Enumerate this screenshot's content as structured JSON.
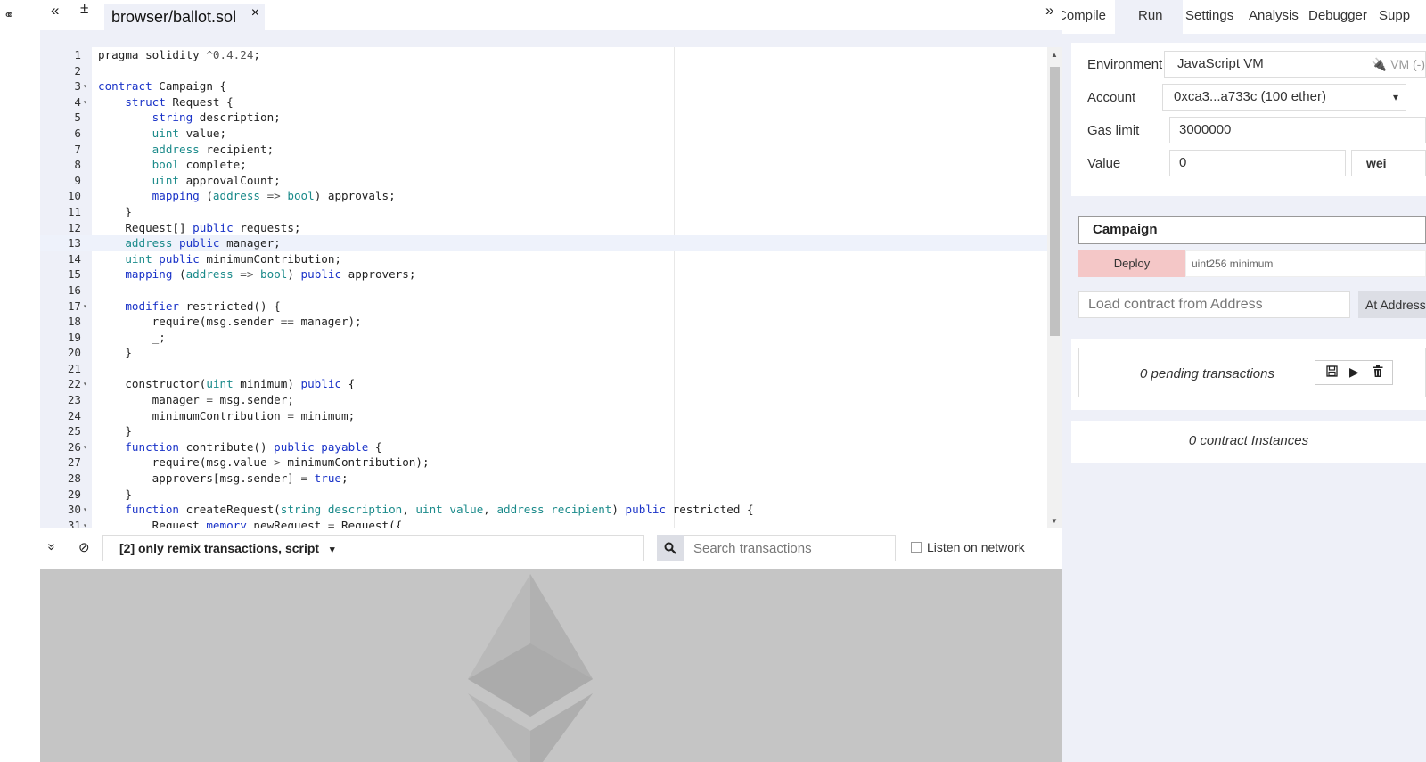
{
  "left_strip": {
    "link_icon": "⚭"
  },
  "editor": {
    "tab_buttons": {
      "collapse_left": "«",
      "new_file": "±",
      "collapse_right": "»"
    },
    "active_tab": "browser/ballot.sol",
    "close_symbol": "×"
  },
  "code_lines": [
    {
      "n": "1",
      "fold": "",
      "html": "pragma solidity <span class=\"op\">^0.4.24</span>;"
    },
    {
      "n": "2",
      "fold": "",
      "html": ""
    },
    {
      "n": "3",
      "fold": "▾",
      "html": "<span class=\"kw\">contract</span> Campaign {"
    },
    {
      "n": "4",
      "fold": "▾",
      "html": "    <span class=\"kw\">struct</span> Request {"
    },
    {
      "n": "5",
      "fold": "",
      "html": "        <span class=\"kw\">string</span> description;"
    },
    {
      "n": "6",
      "fold": "",
      "html": "        <span class=\"ty\">uint</span> value;"
    },
    {
      "n": "7",
      "fold": "",
      "html": "        <span class=\"ty\">address</span> recipient;"
    },
    {
      "n": "8",
      "fold": "",
      "html": "        <span class=\"ty\">bool</span> complete;"
    },
    {
      "n": "9",
      "fold": "",
      "html": "        <span class=\"ty\">uint</span> approvalCount;"
    },
    {
      "n": "10",
      "fold": "",
      "html": "        <span class=\"kw\">mapping</span> (<span class=\"ty\">address</span> <span class=\"op\">=&gt;</span> <span class=\"ty\">bool</span>) approvals;"
    },
    {
      "n": "11",
      "fold": "",
      "html": "    }"
    },
    {
      "n": "12",
      "fold": "",
      "html": "    Request[] <span class=\"kw\">public</span> requests;"
    },
    {
      "n": "13",
      "fold": "",
      "html": "    <span class=\"ty\">address</span> <span class=\"kw\">public</span> manager;",
      "active": true
    },
    {
      "n": "14",
      "fold": "",
      "html": "    <span class=\"ty\">uint</span> <span class=\"kw\">public</span> minimumContribution;"
    },
    {
      "n": "15",
      "fold": "",
      "html": "    <span class=\"kw\">mapping</span> (<span class=\"ty\">address</span> <span class=\"op\">=&gt;</span> <span class=\"ty\">bool</span>) <span class=\"kw\">public</span> approvers;"
    },
    {
      "n": "16",
      "fold": "",
      "html": ""
    },
    {
      "n": "17",
      "fold": "▾",
      "html": "    <span class=\"kw\">modifier</span> restricted() {"
    },
    {
      "n": "18",
      "fold": "",
      "html": "        require(msg.sender <span class=\"op\">==</span> manager);"
    },
    {
      "n": "19",
      "fold": "",
      "html": "        _;"
    },
    {
      "n": "20",
      "fold": "",
      "html": "    }"
    },
    {
      "n": "21",
      "fold": "",
      "html": ""
    },
    {
      "n": "22",
      "fold": "▾",
      "html": "    constructor(<span class=\"ty\">uint</span> minimum) <span class=\"kw\">public</span> {"
    },
    {
      "n": "23",
      "fold": "",
      "html": "        manager <span class=\"op\">=</span> msg.sender;"
    },
    {
      "n": "24",
      "fold": "",
      "html": "        minimumContribution <span class=\"op\">=</span> minimum;"
    },
    {
      "n": "25",
      "fold": "",
      "html": "    }"
    },
    {
      "n": "26",
      "fold": "▾",
      "html": "    <span class=\"kw\">function</span> contribute() <span class=\"kw\">public</span> <span class=\"kw\">payable</span> {"
    },
    {
      "n": "27",
      "fold": "",
      "html": "        require(msg.value <span class=\"op\">&gt;</span> minimumContribution);"
    },
    {
      "n": "28",
      "fold": "",
      "html": "        approvers[msg.sender] <span class=\"op\">=</span> <span class=\"kw\">true</span>;"
    },
    {
      "n": "29",
      "fold": "",
      "html": "    }"
    },
    {
      "n": "30",
      "fold": "▾",
      "html": "    <span class=\"kw\">function</span> createRequest(<span class=\"ty\">string</span> <span class=\"ty\">description</span>, <span class=\"ty\">uint</span> <span class=\"ty\">value</span>, <span class=\"ty\">address</span> <span class=\"ty\">recipient</span>) <span class=\"kw\">public</span> restricted {"
    },
    {
      "n": "31",
      "fold": "▾",
      "html": "        Request <span class=\"kw\">memory</span> newRequest <span class=\"op\">=</span> Request({"
    }
  ],
  "terminal": {
    "collapse_icon": "»",
    "clear_icon": "⊘",
    "filter_label": "[2] only remix transactions, script",
    "filter_caret": "▾",
    "search_icon": "🔍",
    "search_placeholder": "Search transactions",
    "listen_label": "Listen on network"
  },
  "right_panel": {
    "collapse_icon": "»",
    "tabs": [
      "Compile",
      "Run",
      "Settings",
      "Analysis",
      "Debugger",
      "Supp"
    ],
    "active_tab": "Run",
    "environment": {
      "label": "Environment",
      "value": "JavaScript VM",
      "tag": "🔌 VM (-)"
    },
    "account": {
      "label": "Account",
      "value": "0xca3...a733c (100 ether)",
      "caret": "▾"
    },
    "gas_limit": {
      "label": "Gas limit",
      "value": "3000000"
    },
    "value": {
      "label": "Value",
      "value": "0",
      "unit": "wei"
    },
    "contract": "Campaign",
    "deploy": {
      "label": "Deploy",
      "arg_placeholder": "uint256 minimum"
    },
    "load_placeholder": "Load contract from Address",
    "at_address": "At Address",
    "pending": "0 pending transactions",
    "pending_icons": {
      "save": "💾",
      "play": "▶",
      "delete": "🗑"
    },
    "instances": "0 contract Instances"
  },
  "colors": {
    "accent_bg": "#eef0f8",
    "deploy": "#f4c7c7",
    "keyword": "#1a33c8",
    "type": "#1a8a8a"
  }
}
